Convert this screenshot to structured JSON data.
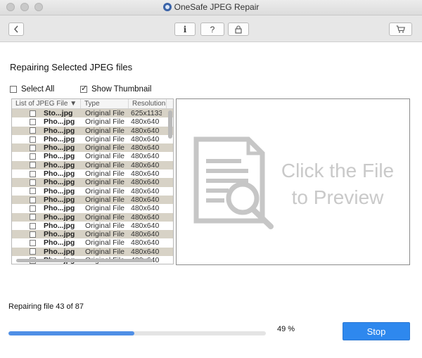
{
  "window": {
    "title": "OneSafe JPEG Repair"
  },
  "toolbar": {
    "back_icon": "chevron-left-icon",
    "info_label": "i",
    "help_label": "?",
    "lock_icon": "lock-icon",
    "cart_icon": "cart-icon"
  },
  "heading": "Repairing Selected JPEG files",
  "select_all_label": "Select All",
  "show_thumbnail_label": "Show Thumbnail",
  "show_thumbnail_checked": true,
  "list": {
    "columns": [
      "List of JPEG File ▼",
      "Type",
      "Resolution"
    ],
    "rows": [
      {
        "name": "Sto...jpg",
        "type": "Original File",
        "resolution": "625x1133"
      },
      {
        "name": "Pho...jpg",
        "type": "Original File",
        "resolution": "480x640"
      },
      {
        "name": "Pho...jpg",
        "type": "Original File",
        "resolution": "480x640"
      },
      {
        "name": "Pho...jpg",
        "type": "Original File",
        "resolution": "480x640"
      },
      {
        "name": "Pho...jpg",
        "type": "Original File",
        "resolution": "480x640"
      },
      {
        "name": "Pho...jpg",
        "type": "Original File",
        "resolution": "480x640"
      },
      {
        "name": "Pho...jpg",
        "type": "Original File",
        "resolution": "480x640"
      },
      {
        "name": "Pho...jpg",
        "type": "Original File",
        "resolution": "480x640"
      },
      {
        "name": "Pho...jpg",
        "type": "Original File",
        "resolution": "480x640"
      },
      {
        "name": "Pho...jpg",
        "type": "Original File",
        "resolution": "480x640"
      },
      {
        "name": "Pho...jpg",
        "type": "Original File",
        "resolution": "480x640"
      },
      {
        "name": "Pho...jpg",
        "type": "Original File",
        "resolution": "480x640"
      },
      {
        "name": "Pho...jpg",
        "type": "Original File",
        "resolution": "480x640"
      },
      {
        "name": "Pho...jpg",
        "type": "Original File",
        "resolution": "480x640"
      },
      {
        "name": "Pho...jpg",
        "type": "Original File",
        "resolution": "480x640"
      },
      {
        "name": "Pho...jpg",
        "type": "Original File",
        "resolution": "480x640"
      },
      {
        "name": "Pho...jpg",
        "type": "Original File",
        "resolution": "480x640"
      },
      {
        "name": "Pho...jpg",
        "type": "Original File",
        "resolution": "480x640"
      }
    ]
  },
  "preview": {
    "line1": "Click the File",
    "line2": "to Preview",
    "icon": "document-search-icon"
  },
  "status_text": "Repairing file 43 of 87",
  "progress": {
    "value": 49,
    "label": "49 %"
  },
  "stop_label": "Stop",
  "colors": {
    "accent": "#2e88ee",
    "progress": "#4f8fe6",
    "row_alt": "#d7d2c6"
  }
}
